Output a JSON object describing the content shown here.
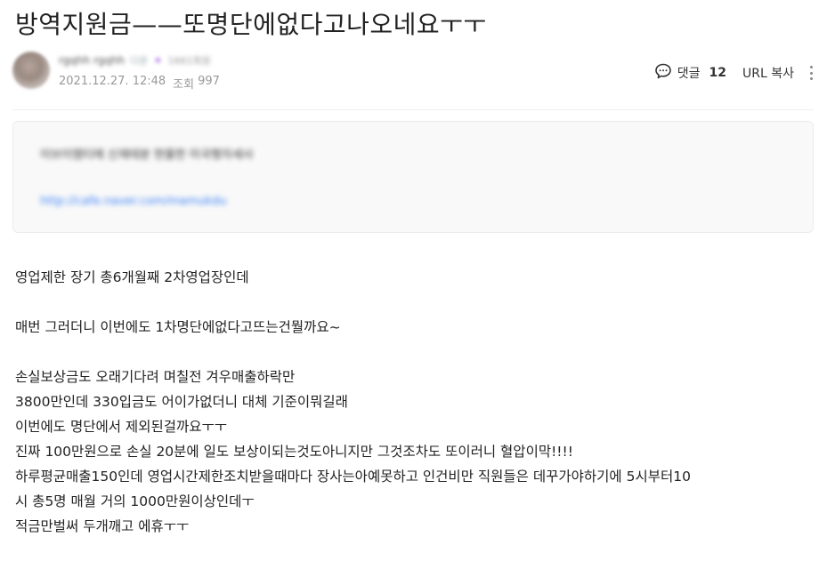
{
  "post": {
    "title": "방역지원금——또명단에없다고나오네요ㅜㅜ",
    "author": {
      "name": "rgqhh rgqhh",
      "grade": "다운",
      "extra": "1661회원"
    },
    "date": "2021.12.27. 12:48",
    "views_label": "조회",
    "views": "997"
  },
  "actions": {
    "comments_label": "댓글",
    "comments_count": "12",
    "url_copy_label": "URL 복사"
  },
  "link_preview": {
    "title": "이브이엠티에 신재테분 현물한 미국행자세사",
    "url": "http://cafe.naver.com/mamukdu"
  },
  "body": {
    "lines": [
      "영업제한 장기 총6개월째 2차영업장인데",
      "",
      "매번 그러더니 이번에도 1차명단에없다고뜨는건뭘까요~",
      "",
      "손실보상금도 오래기다려 며칠전 겨우매출하락만",
      "3800만인데 330입금도 어이가없더니 대체 기준이뭐길래",
      "이번에도 명단에서 제외된걸까요ㅜㅜ",
      "진짜 100만원으로 손실 20분에 일도 보상이되는것도아니지만 그것조차도  또이러니 혈압이막!!!!",
      "하루평균매출150인데 영업시간제한조치받을때마다 장사는아예못하고 인건비만 직원들은 데꾸가야하기에 5시부터10",
      "시 총5명 매월 거의 1000만원이상인데ㅜ",
      "적금만벌써 두개깨고 에휴ㅜㅜ"
    ]
  },
  "icons": {
    "comment": "comment-bubble-icon",
    "more": "more-vertical-icon"
  }
}
